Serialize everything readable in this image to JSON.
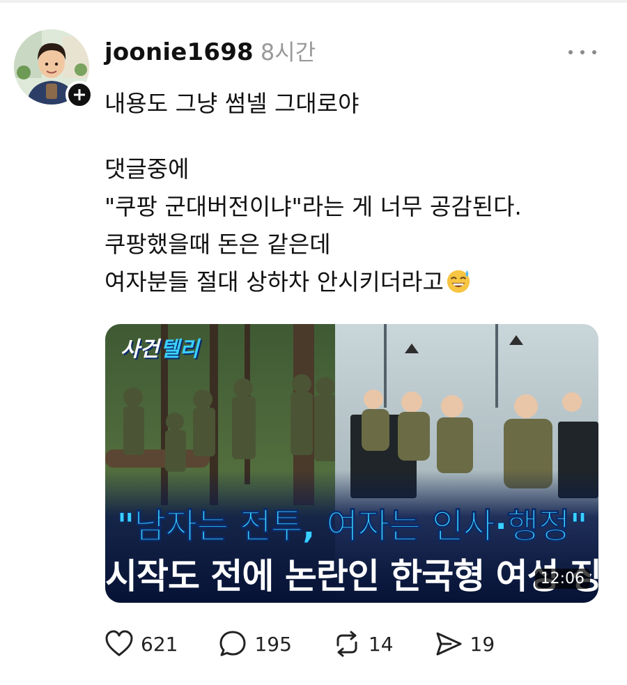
{
  "post": {
    "username": "joonie1698",
    "timestamp": "8시간",
    "lines": [
      "내용도 그냥 썸넬 그대로야",
      "댓글중에",
      "\"쿠팡 군대버전이냐\"라는 게 너무 공감된다.",
      "쿠팡했을때 돈은 같은데",
      "여자분들 절대 상하차 안시키더라고"
    ],
    "emoji": "sweat-smile-emoji"
  },
  "media": {
    "channel_tag_main": "사건",
    "channel_tag_accent": "텔리",
    "title_line1": "\"남자는 전투, 여자는 인사·행정\"",
    "title_line2": "시작도 전에 논란인 한국형 여성 징병",
    "duration": "12:06"
  },
  "actions": {
    "likes": "621",
    "comments": "195",
    "reposts": "14",
    "shares": "19"
  },
  "icons": {
    "like": "heart-icon",
    "comment": "comment-bubble-icon",
    "repost": "repost-icon",
    "share": "send-icon",
    "more": "more-dots-icon",
    "follow": "plus-icon"
  },
  "colors": {
    "accent_blue": "#39d0ff",
    "muted_gray": "#9a9a9a"
  }
}
